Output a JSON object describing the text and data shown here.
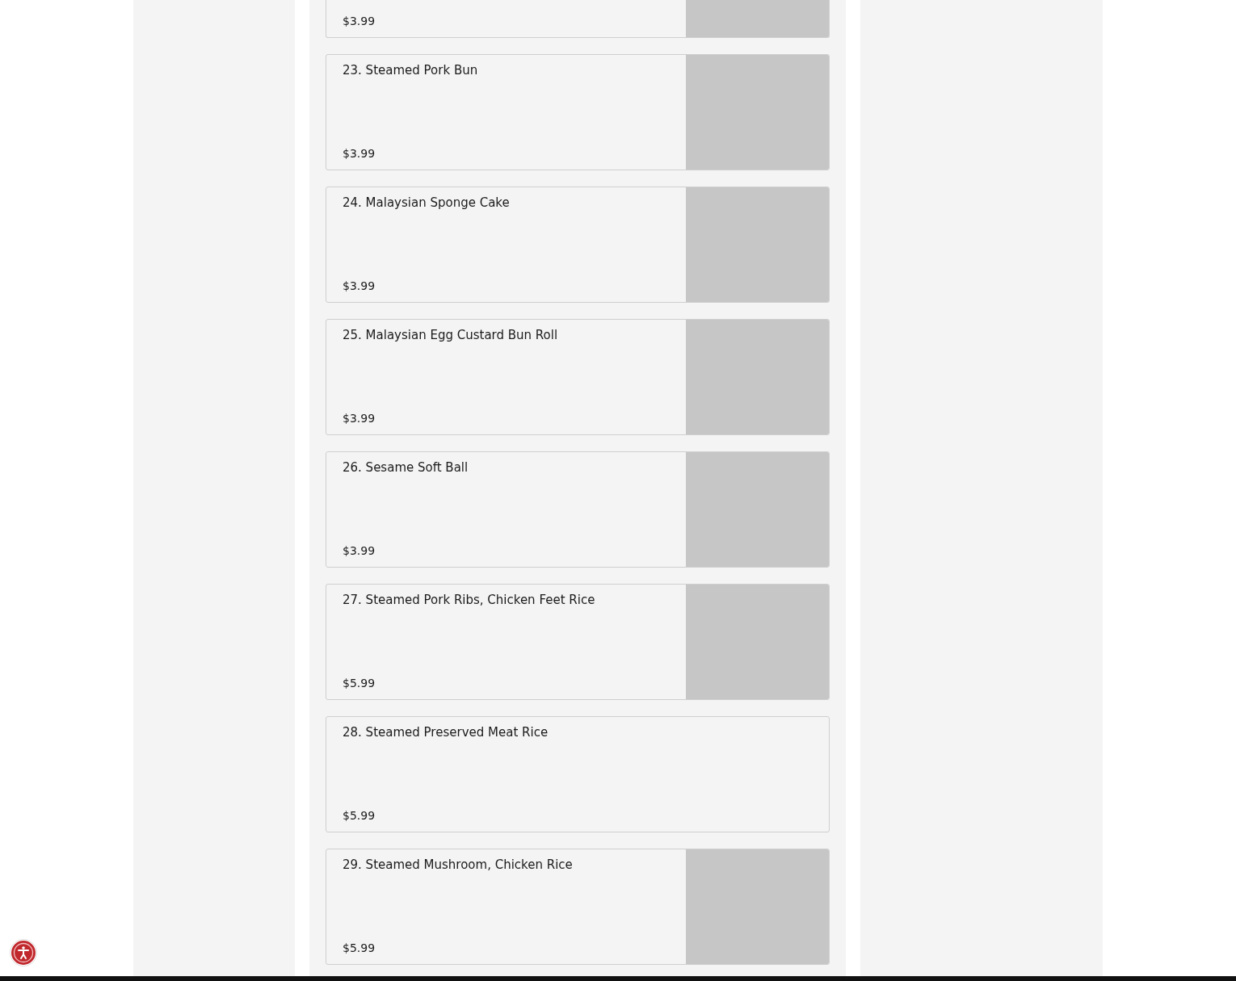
{
  "menu_items": [
    {
      "kind": "cut",
      "price": "$3.99",
      "has_image": true
    },
    {
      "kind": "full",
      "name": "23. Steamed Pork Bun",
      "price": "$3.99",
      "has_image": true
    },
    {
      "kind": "full",
      "name": "24. Malaysian Sponge Cake",
      "price": "$3.99",
      "has_image": true
    },
    {
      "kind": "full",
      "name": "25. Malaysian Egg Custard Bun Roll",
      "price": "$3.99",
      "has_image": true
    },
    {
      "kind": "full",
      "name": "26. Sesame Soft Ball",
      "price": "$3.99",
      "has_image": true
    },
    {
      "kind": "full",
      "name": "27. Steamed Pork Ribs, Chicken Feet Rice",
      "price": "$5.99",
      "has_image": true
    },
    {
      "kind": "full",
      "name": "28. Steamed Preserved Meat Rice",
      "price": "$5.99",
      "has_image": false
    },
    {
      "kind": "full",
      "name": "29. Steamed Mushroom, Chicken Rice",
      "price": "$5.99",
      "has_image": true
    }
  ]
}
